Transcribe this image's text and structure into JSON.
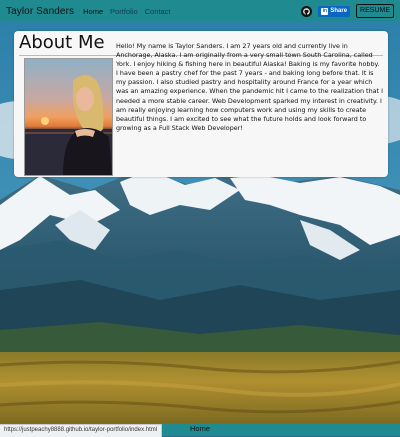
{
  "navbar": {
    "brand": "Taylor Sanders",
    "links": [
      {
        "label": "Home",
        "active": true
      },
      {
        "label": "Portfolio",
        "active": false
      },
      {
        "label": "Contact",
        "active": false
      }
    ],
    "github_icon": "github-icon",
    "share_label": "Share",
    "share_icon": "linkedin-icon",
    "resume_label": "RESUME"
  },
  "about": {
    "title": "About Me",
    "photo": "profile-photo",
    "bio": "Hello! My name is Taylor Sanders. I am 27 years old and currently live in Anchorage, Alaska. I am originally from a very small town South Carolina, called York. I enjoy hiking & fishing here in beautiful Alaska! Baking is my favorite hobby. I have been a pastry chef for the past 7 years - and baking long before that. It is my passion. I also studied pastry and hospitality around France for a year which was an amazing experience. When the pandemic hit I came to the realization that I needed a more stable career. Web Development sparked my interest in creativity. I am really enjoying learning how computers work and using my skills to create beautiful things. I am excited to see what the future holds and look forward to growing as a Full Stack Web Developer!"
  },
  "footer": {
    "link_label": "Home"
  },
  "status_bar": {
    "url": "https://justpeachy8888.github.io/taylor-portfolio/index.html"
  },
  "colors": {
    "navbar": "#1f8a8f",
    "card": "#f7f7f8",
    "sky": "#2a6a8a"
  }
}
